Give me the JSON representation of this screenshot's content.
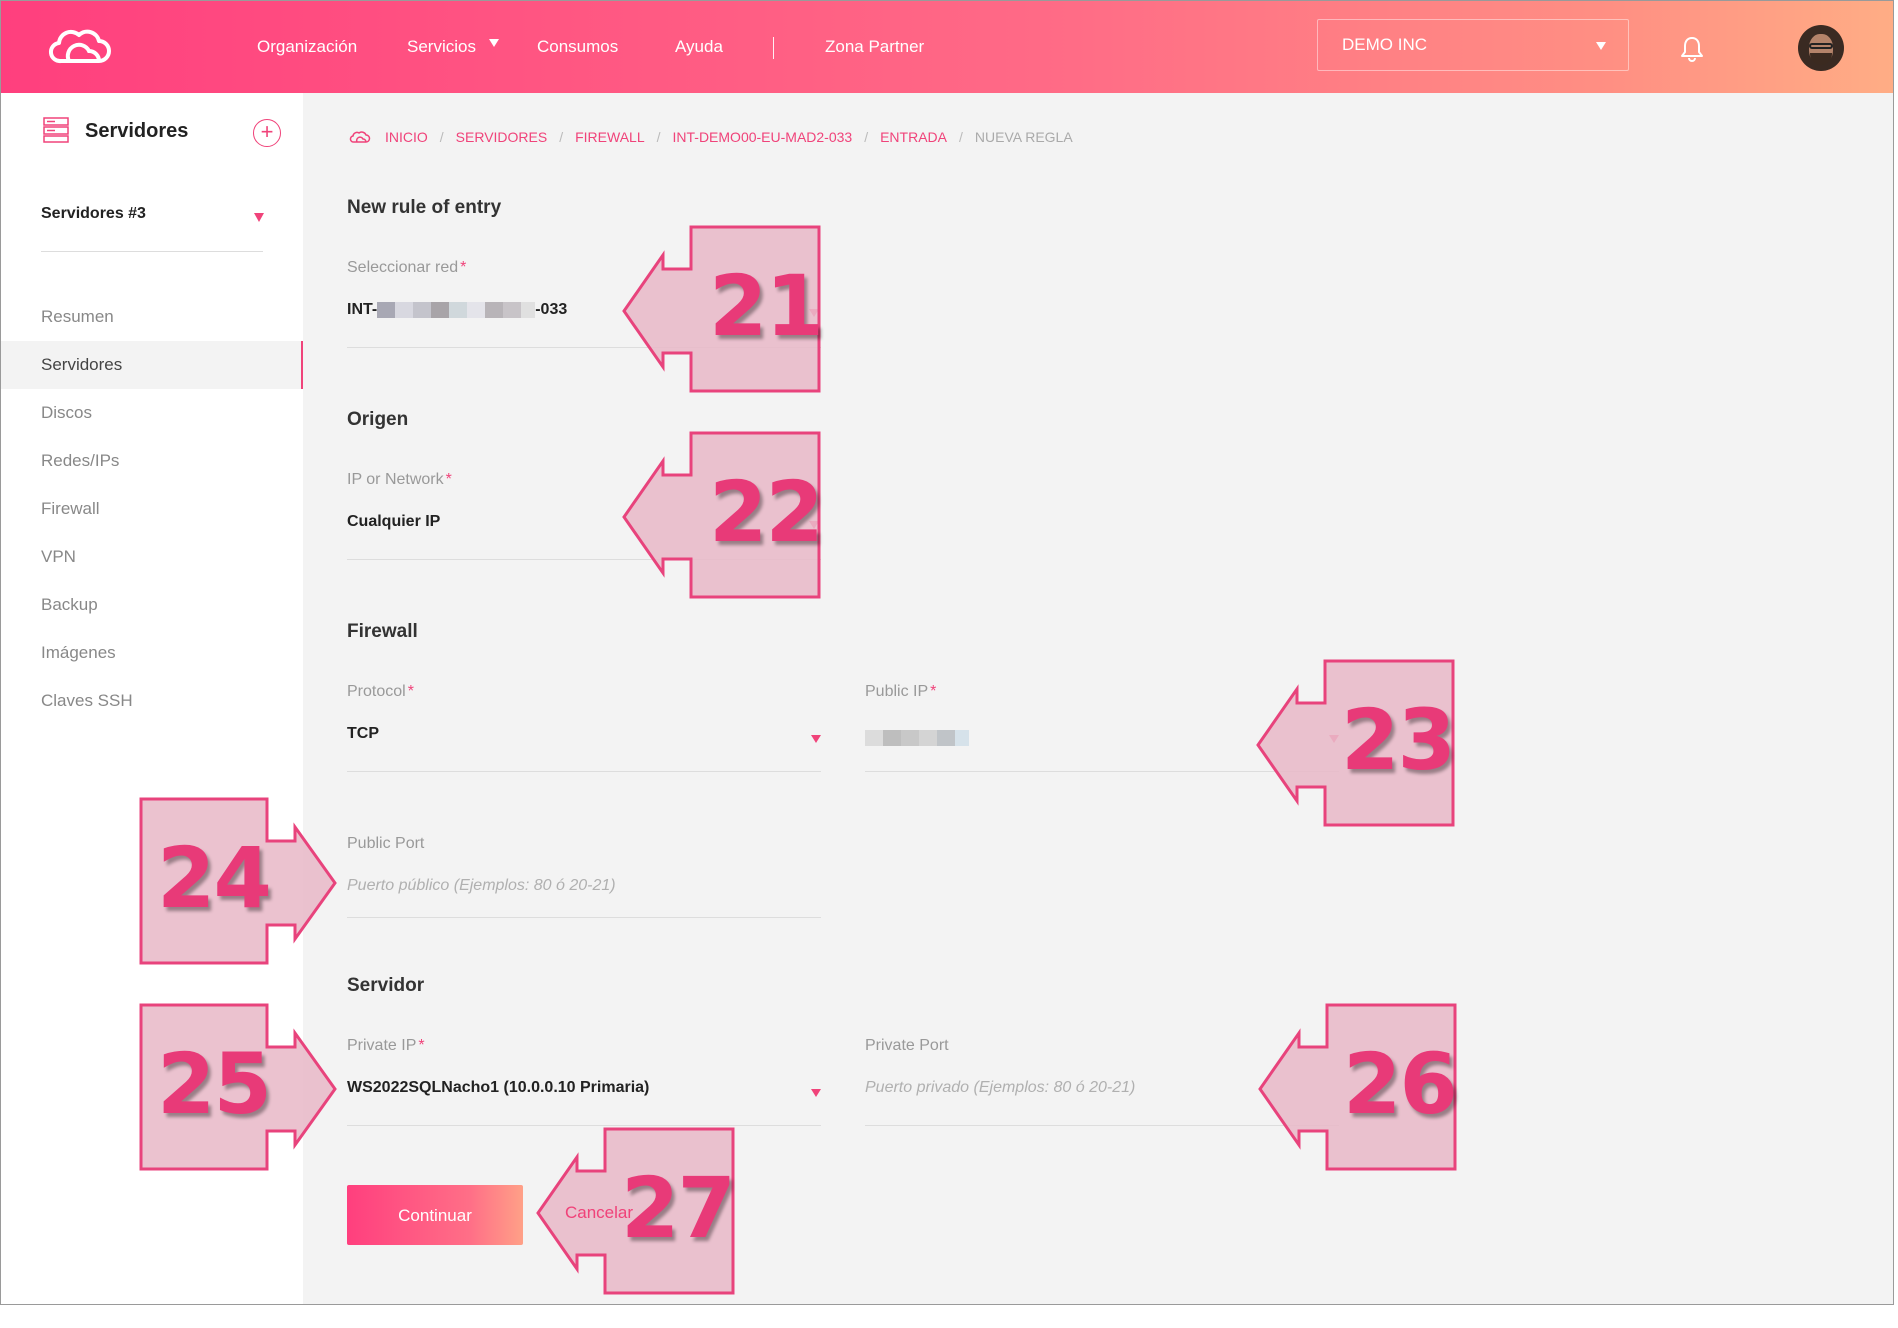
{
  "header": {
    "nav": [
      "Organización",
      "Servicios",
      "Consumos",
      "Ayuda",
      "Zona Partner"
    ],
    "org_select": "DEMO INC"
  },
  "sidebar": {
    "title": "Servidores",
    "selector": "Servidores #3",
    "items": [
      "Resumen",
      "Servidores",
      "Discos",
      "Redes/IPs",
      "Firewall",
      "VPN",
      "Backup",
      "Imágenes",
      "Claves SSH"
    ],
    "active_index": 1
  },
  "breadcrumb": {
    "links": [
      "INICIO",
      "SERVIDORES",
      "FIREWALL",
      "INT-DEMO00-EU-MAD2-033",
      "ENTRADA"
    ],
    "current": "NUEVA REGLA"
  },
  "form": {
    "title": "New rule of entry",
    "network": {
      "label": "Seleccionar red",
      "value_prefix": "INT-",
      "value_suffix": "-033"
    },
    "origin": {
      "title": "Origen",
      "label": "IP or Network",
      "value": "Cualquier IP"
    },
    "firewall": {
      "title": "Firewall",
      "protocol_label": "Protocol",
      "protocol_value": "TCP",
      "public_ip_label": "Public IP",
      "public_port_label": "Public Port",
      "public_port_placeholder": "Puerto público (Ejemplos: 80 ó 20-21)"
    },
    "server": {
      "title": "Servidor",
      "private_ip_label": "Private IP",
      "private_ip_value": "WS2022SQLNacho1 (10.0.0.10 Primaria)",
      "private_port_label": "Private Port",
      "private_port_placeholder": "Puerto privado (Ejemplos: 80 ó 20-21)"
    },
    "required_mark": "*",
    "continue": "Continuar",
    "cancel": "Cancelar"
  },
  "callouts": [
    "21",
    "22",
    "23",
    "24",
    "25",
    "26",
    "27"
  ],
  "colors": {
    "accent": "#f0437a",
    "callout_fill": "#e8b9c8",
    "callout_stroke": "#e8437c"
  }
}
